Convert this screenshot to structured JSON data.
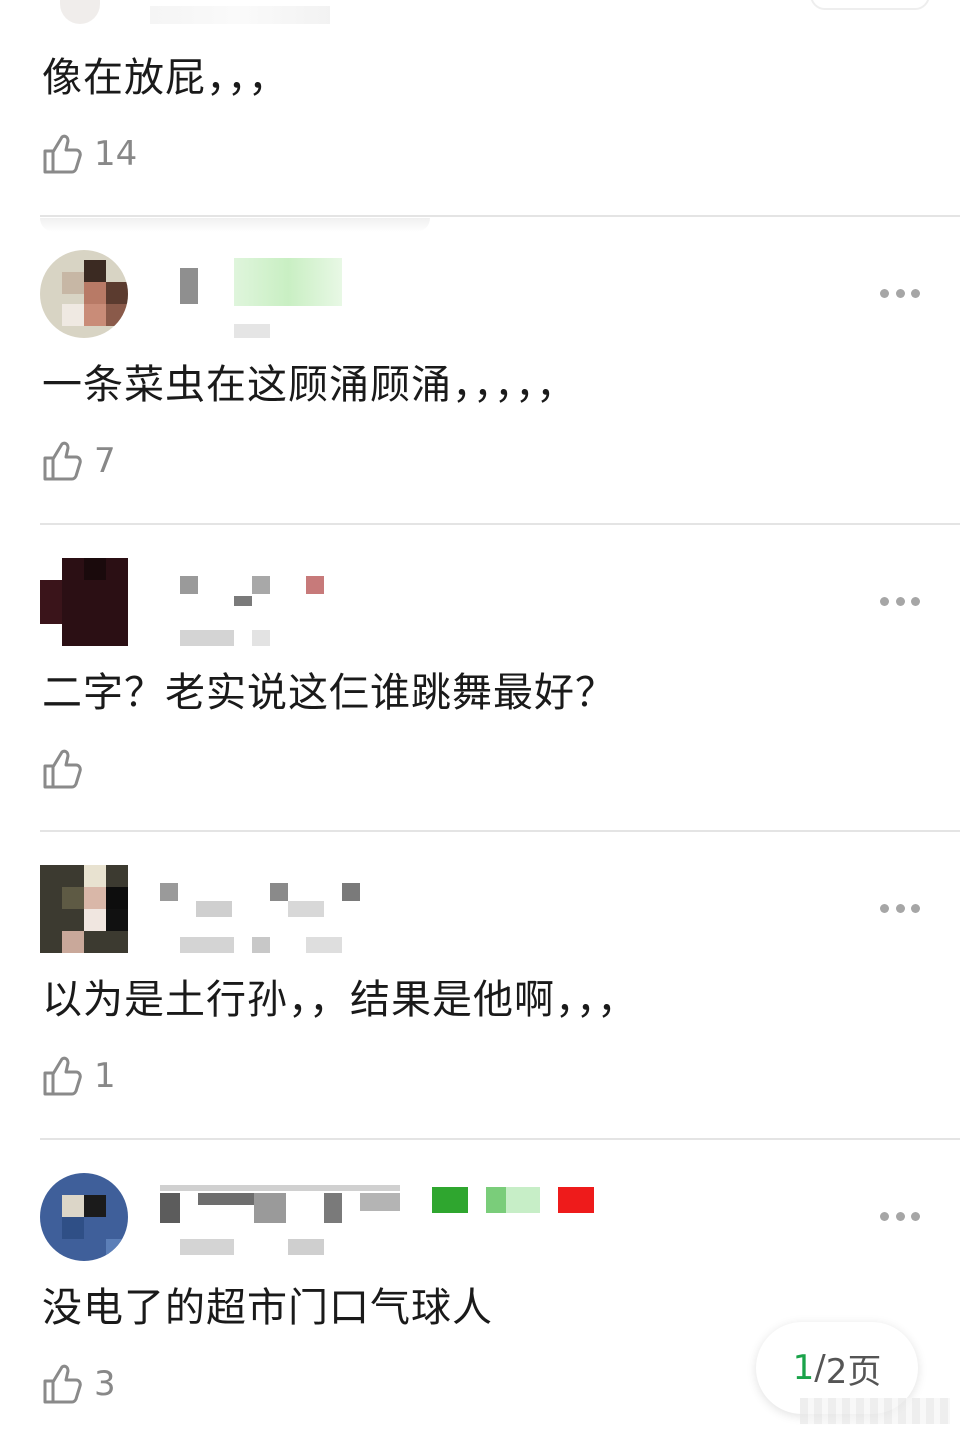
{
  "comments": [
    {
      "text": "像在放屁，，，",
      "likes": "14"
    },
    {
      "text": "一条菜虫在这顾涌顾涌，，，，，",
      "likes": "7"
    },
    {
      "text": "二字？老实说这仨谁跳舞最好？",
      "likes": ""
    },
    {
      "text": "以为是土行孙，，结果是他啊，，，",
      "likes": "1"
    },
    {
      "text": "没电了的超市门口气球人",
      "likes": "3"
    }
  ],
  "pager": {
    "current": "1",
    "separator": "/",
    "total_label": "2页"
  },
  "colors": {
    "accent": "#1aa34a",
    "text": "#1a1a1a",
    "muted": "#888888",
    "divider": "#e4e4e4"
  },
  "icons": {
    "like": "thumbs-up-icon",
    "more": "more-dots-icon"
  }
}
